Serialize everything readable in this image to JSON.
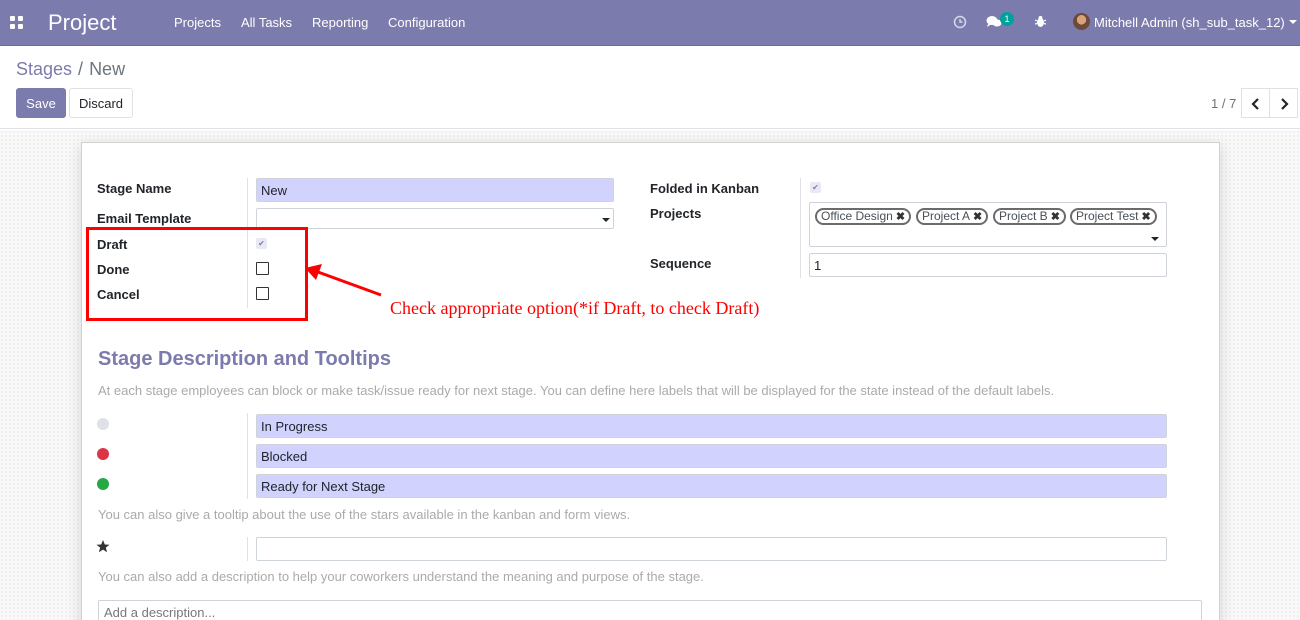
{
  "navbar": {
    "app_name": "Project",
    "menu": [
      "Projects",
      "All Tasks",
      "Reporting",
      "Configuration"
    ],
    "chat_count": "1",
    "user": "Mitchell Admin (sh_sub_task_12)",
    "icons": [
      "apps-icon",
      "clock-icon",
      "chat-icon",
      "bug-icon",
      "avatar"
    ]
  },
  "breadcrumb": {
    "parent": "Stages",
    "separator": "/",
    "current": "New"
  },
  "buttons": {
    "save": "Save",
    "discard": "Discard"
  },
  "pager": {
    "value": "1 / 7",
    "prev": "‹",
    "next": "›"
  },
  "form": {
    "stage_name_label": "Stage Name",
    "stage_name_value": "New",
    "email_template_label": "Email Template",
    "email_template_value": "",
    "draft_label": "Draft",
    "draft_checked": true,
    "done_label": "Done",
    "done_checked": false,
    "cancel_label": "Cancel",
    "cancel_checked": false,
    "folded_label": "Folded in Kanban",
    "folded_checked": true,
    "projects_label": "Projects",
    "projects": [
      "Office Design",
      "Project A",
      "Project B",
      "Project Test"
    ],
    "sequence_label": "Sequence",
    "sequence_value": "1"
  },
  "annotation": {
    "text": "Check appropriate option(*if Draft, to check Draft)",
    "color": "#ff0000"
  },
  "description_section": {
    "title": "Stage Description and Tooltips",
    "help1": "At each stage employees can block or make task/issue ready for next stage. You can define here labels that will be displayed for the state instead of the default labels.",
    "states": [
      {
        "label": "In Progress",
        "color": "#dee2e6"
      },
      {
        "label": "Blocked",
        "color": "#dc3545"
      },
      {
        "label": "Ready for Next Stage",
        "color": "#28a745"
      }
    ],
    "help2": "You can also give a tooltip about the use of the stars available in the kanban and form views.",
    "star_value": "",
    "help3": "You can also add a description to help your coworkers understand the meaning and purpose of the stage.",
    "description_placeholder": "Add a description..."
  },
  "colors": {
    "brand": "#7c7bad",
    "required_field": "#d2d2ff",
    "annotation": "#ff0000"
  }
}
